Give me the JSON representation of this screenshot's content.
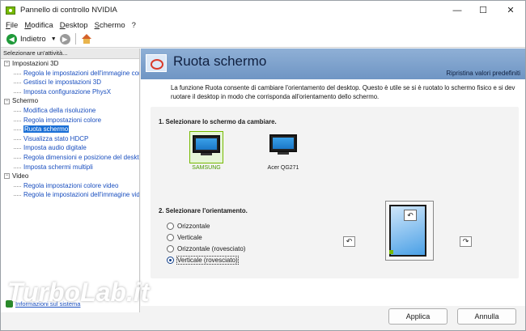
{
  "window": {
    "title": "Pannello di controllo NVIDIA",
    "minimize": "—",
    "maximize": "☐",
    "close": "✕"
  },
  "menu": [
    "File",
    "Modifica",
    "Desktop",
    "Schermo",
    "?"
  ],
  "toolbar": {
    "back_label": "Indietro"
  },
  "sidebar": {
    "header": "Selezionare un'attività...",
    "categories": [
      {
        "label": "Impostazioni 3D",
        "items": [
          "Regola le impostazioni dell'immagine con",
          "Gestisci le impostazioni 3D",
          "Imposta configurazione PhysX"
        ]
      },
      {
        "label": "Schermo",
        "items": [
          "Modifica della risoluzione",
          "Regola impostazioni colore",
          "Ruota schermo",
          "Visualizza stato HDCP",
          "Imposta audio digitale",
          "Regola dimensioni e posizione del desktop",
          "Imposta schermi multipli"
        ]
      },
      {
        "label": "Video",
        "items": [
          "Regola impostazioni colore video",
          "Regola le impostazioni dell'immagine vide"
        ]
      }
    ],
    "selected": "Ruota schermo",
    "footer": "Informazioni sul sistema"
  },
  "main": {
    "title": "Ruota schermo",
    "restore": "Ripristina valori predefiniti",
    "description": "La funzione Ruota consente di cambiare l'orientamento del desktop. Questo è utile se si è ruotato lo schermo fisico e si dev ruotare il desktop in modo che corrisponda all'orientamento dello schermo.",
    "step1": "1. Selezionare lo schermo da cambiare.",
    "monitors": [
      {
        "label": "SAMSUNG",
        "selected": true
      },
      {
        "label": "Acer QG271",
        "selected": false
      }
    ],
    "step2": "2. Selezionare l'orientamento.",
    "orientations": [
      {
        "label": "Orizzontale",
        "checked": false
      },
      {
        "label": "Verticale",
        "checked": false
      },
      {
        "label": "Orizzontale (rovesciato)",
        "checked": false
      },
      {
        "label": "Verticale (rovesciato)",
        "checked": true
      }
    ]
  },
  "buttons": {
    "apply": "Applica",
    "cancel": "Annulla"
  },
  "watermark": "TurboLab.it"
}
